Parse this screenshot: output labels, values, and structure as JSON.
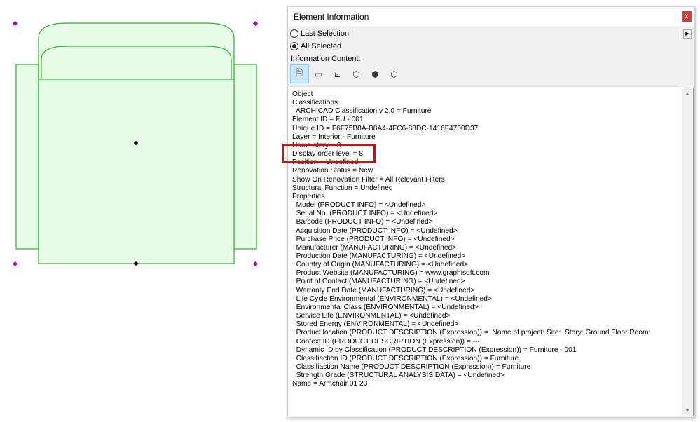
{
  "window": {
    "title": "Element Information",
    "close_label": "x"
  },
  "options": {
    "last_selection": "Last Selection",
    "all_selected": "All Selected",
    "selected": "all_selected"
  },
  "info_content_label": "Information Content:",
  "content_icons": [
    "document-icon",
    "2d-view-icon",
    "2d-axes-icon",
    "3d-box-icon",
    "3d-solid-icon",
    "3d-axes-icon"
  ],
  "lines": [
    "Object",
    "Classifications",
    "  ARCHICAD Classification v 2.0 = Furniture",
    "Element ID = FU - 001",
    "Unique ID = F6F75B8A-B8A4-4FC6-88DC-1416F4700D37",
    "Layer = Interior - Furniture",
    "Home story = 0",
    "Display order level = 8",
    "Position = Undefined",
    "Renovation Status = New",
    "Show On Renovation Filter = All Relevant Filters",
    "Structural Function = Undefined",
    "Properties",
    "  Model (PRODUCT INFO) = <Undefined>",
    "  Serial No. (PRODUCT INFO) = <Undefined>",
    "  Barcode (PRODUCT INFO) = <Undefined>",
    "  Acquisition Date (PRODUCT INFO) = <Undefined>",
    "  Purchase Price (PRODUCT INFO) = <Undefined>",
    "  Manufacturer (MANUFACTURING) = <Undefined>",
    "  Production Date (MANUFACTURING) = <Undefined>",
    "  Country of Origin (MANUFACTURING) = <Undefined>",
    "  Product Website (MANUFACTURING) = www.graphisoft.com",
    "  Point of Contact (MANUFACTURING) = <Undefined>",
    "  Warranty End Date (MANUFACTURING) = <Undefined>",
    "  Life Cycle Environmental (ENVIRONMENTAL) = <Undefined>",
    "  Environmental Class (ENVIRONMENTAL) = <Undefined>",
    "  Service Life (ENVIRONMENTAL) = <Undefined>",
    "  Stored Energy (ENVIRONMENTAL) = <Undefined>",
    "  Product location (PRODUCT DESCRIPTION (Expression)) =  Name of project: Site:  Story: Ground Floor Room:",
    "  Context ID (PRODUCT DESCRIPTION (Expression)) = ---",
    "  Dynamic ID by Classification (PRODUCT DESCRIPTION (Expression)) = Furniture - 001",
    "  Classifiaction ID (PRODUCT DESCRIPTION (Expression)) = Furniture",
    "  Classifiaction Name (PRODUCT DESCRIPTION (Expression)) = Furniture",
    "  Strength Grade (STRUCTURAL ANALYSIS DATA) = <Undefined>",
    "Name = Armchair 01 23"
  ],
  "colors": {
    "highlight": "#e00000",
    "furniture_fill": "#e6fce6",
    "furniture_stroke": "#2bb52b",
    "hotspot": "#b000b0"
  }
}
